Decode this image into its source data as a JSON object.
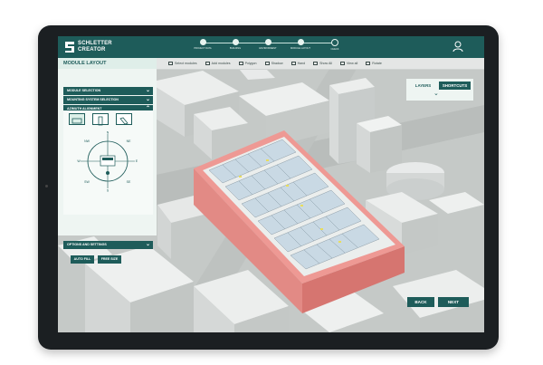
{
  "brand": {
    "line1": "SCHLETTER",
    "line2": "CREATOR"
  },
  "steps": [
    {
      "label": "PROJECT DATA",
      "state": "done"
    },
    {
      "label": "BUILDING",
      "state": "done"
    },
    {
      "label": "ENVIRONMENT",
      "state": "done"
    },
    {
      "label": "MODULE LAYOUT",
      "state": "current"
    },
    {
      "label": "CHECK",
      "state": "todo"
    }
  ],
  "toolbar": {
    "panel_title": "MODULE LAYOUT",
    "tools": [
      {
        "label": "Select modules",
        "icon": "select-icon"
      },
      {
        "label": "Add modules",
        "icon": "add-icon"
      },
      {
        "label": "Polygon",
        "icon": "polygon-icon"
      },
      {
        "label": "Shadow",
        "icon": "shadow-icon"
      },
      {
        "label": "Hand",
        "icon": "hand-icon"
      },
      {
        "label": "Show All",
        "icon": "show-all-icon"
      },
      {
        "label": "View all",
        "icon": "view-all-icon"
      },
      {
        "label": "Rotate",
        "icon": "rotate-icon"
      }
    ]
  },
  "panel": {
    "sections": [
      {
        "label": "MODULE SELECTION"
      },
      {
        "label": "MOUNTING SYSTEM SELECTION"
      },
      {
        "label": "AZIMUTH ALIGNMENT"
      }
    ],
    "compass": {
      "n": "N",
      "ne": "NE",
      "e": "E",
      "se": "SE",
      "s": "S",
      "sw": "SW",
      "w": "W",
      "nw": "NW"
    },
    "options_label": "OPTIONS AND SETTINGS",
    "auto_fill": "AUTO FILL",
    "free_size": "FREE SIZE"
  },
  "right_panel": {
    "layers": "LAYERS",
    "shortcuts": "SHORTCUTS"
  },
  "nav": {
    "back": "BACK",
    "next": "NEXT"
  },
  "colors": {
    "brand": "#1e5c5a",
    "highlight_building": "#e88682",
    "solar_panel": "#c9d9e4"
  }
}
